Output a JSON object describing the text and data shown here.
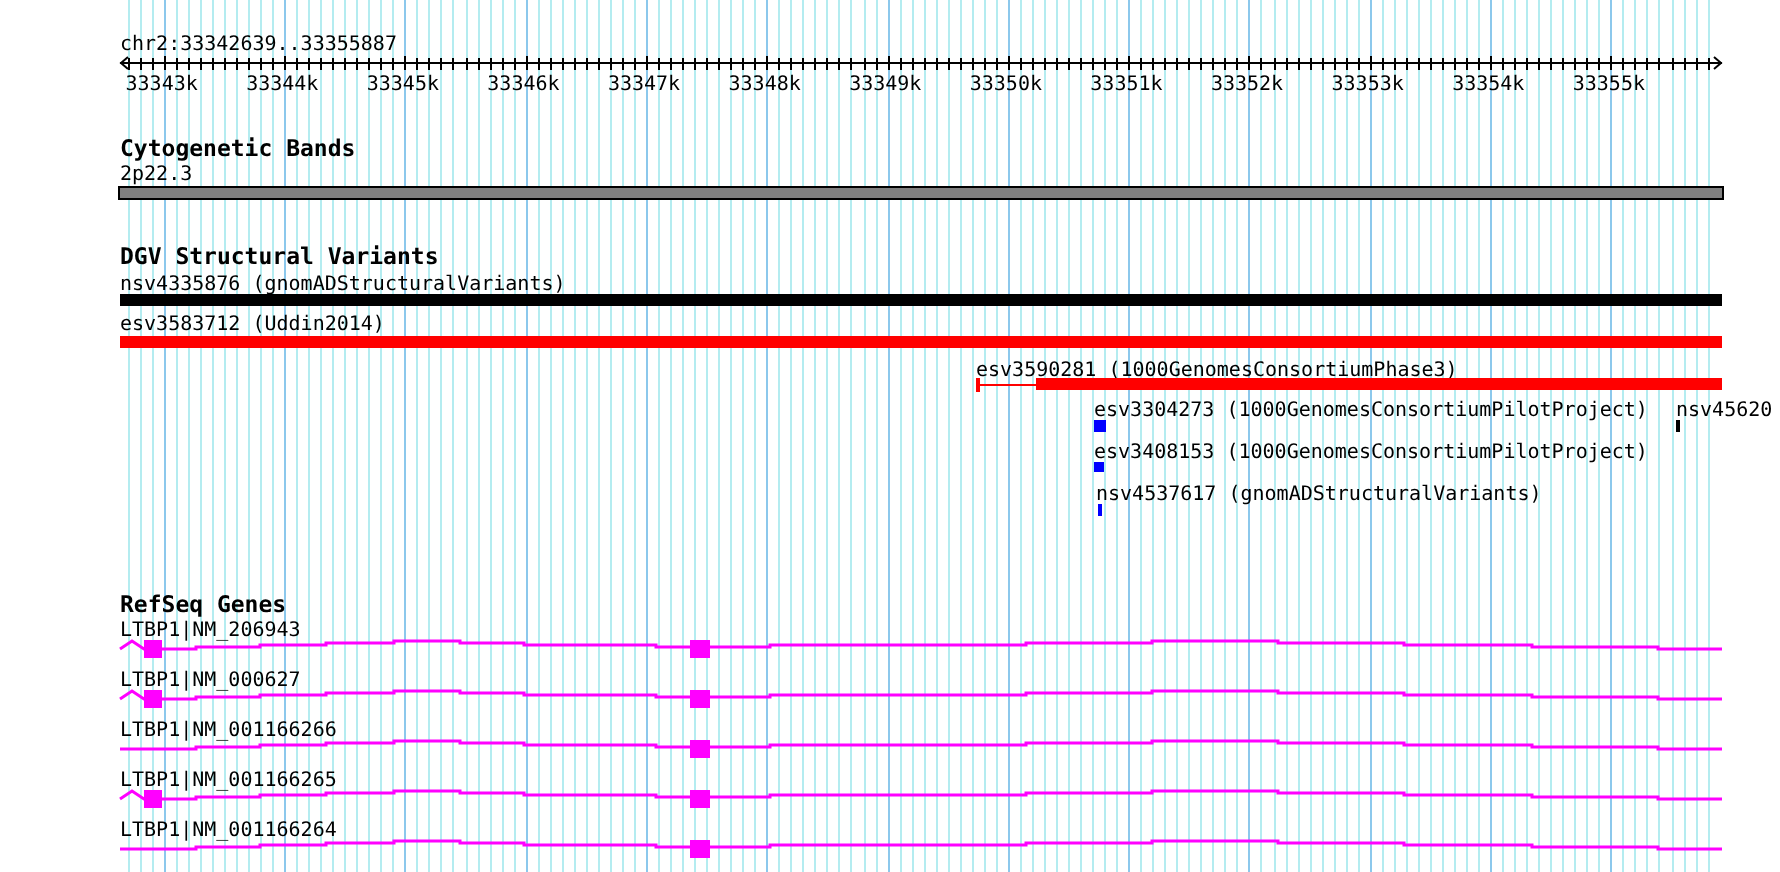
{
  "location": "chr2:33342639..33355887",
  "ruler": {
    "tick_labels": [
      "33343k",
      "33344k",
      "33345k",
      "33346k",
      "33347k",
      "33348k",
      "33349k",
      "33350k",
      "33351k",
      "33352k",
      "33353k",
      "33354k",
      "33355k"
    ]
  },
  "tracks": [
    {
      "kind": "bands",
      "title": "Cytogenetic Bands",
      "features": [
        {
          "label": "2p22.3"
        }
      ]
    },
    {
      "kind": "variants",
      "title": "DGV Structural Variants",
      "features": [
        {
          "label": "nsv4335876 (gnomADStructuralVariants)",
          "color": "#000000"
        },
        {
          "label": "esv3583712 (Uddin2014)",
          "color": "#ff0000"
        },
        {
          "label": "esv3590281 (1000GenomesConsortiumPhase3)",
          "color": "#ff0000"
        },
        {
          "label": "esv3304273 (1000GenomesConsortiumPilotProject)",
          "color": "#0000ff"
        },
        {
          "label": "nsv45620",
          "color": "#000000"
        },
        {
          "label": "esv3408153 (1000GenomesConsortiumPilotProject)",
          "color": "#0000ff"
        },
        {
          "label": "nsv4537617 (gnomADStructuralVariants)",
          "color": "#0000ff"
        }
      ]
    },
    {
      "kind": "genes",
      "title": "RefSeq Genes",
      "features": [
        {
          "label": "LTBP1|NM_206943"
        },
        {
          "label": "LTBP1|NM_000627"
        },
        {
          "label": "LTBP1|NM_001166266"
        },
        {
          "label": "LTBP1|NM_001166265"
        },
        {
          "label": "LTBP1|NM_001166264"
        }
      ]
    }
  ]
}
